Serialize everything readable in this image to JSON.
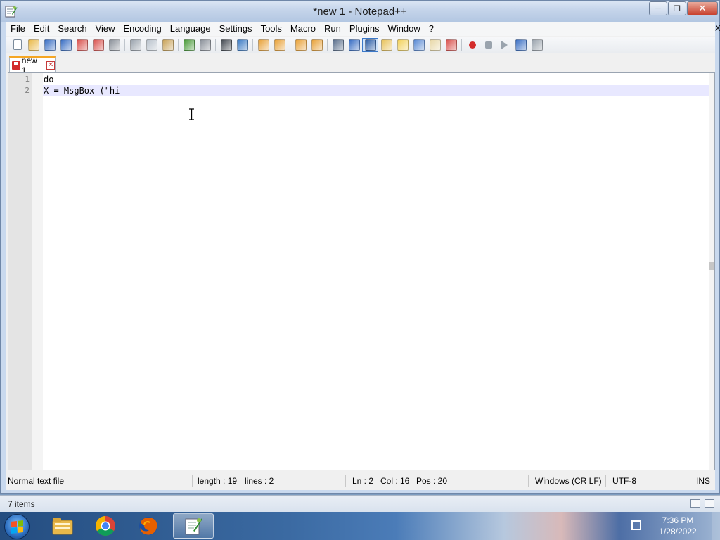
{
  "window": {
    "title": "*new 1 - Notepad++",
    "minimize_glyph": "─",
    "maximize_glyph": "❐",
    "close_glyph": "✕"
  },
  "menu": {
    "items": [
      "File",
      "Edit",
      "Search",
      "View",
      "Encoding",
      "Language",
      "Settings",
      "Tools",
      "Macro",
      "Run",
      "Plugins",
      "Window",
      "?"
    ],
    "close_glyph": "X"
  },
  "toolbar": {
    "icons": [
      "new-file-icon",
      "open-file-icon",
      "save-icon",
      "save-all-icon",
      "close-icon",
      "close-all-icon",
      "print-icon",
      "|",
      "cut-icon",
      "copy-icon",
      "paste-icon",
      "|",
      "undo-icon",
      "redo-icon",
      "|",
      "find-icon",
      "replace-icon",
      "|",
      "zoom-in-icon",
      "zoom-out-icon",
      "|",
      "sync-vertical-icon",
      "sync-horizontal-icon",
      "|",
      "word-wrap-icon",
      "show-all-chars-icon",
      "indent-guide-icon",
      "user-language-icon",
      "doc-map-icon",
      "function-list-icon",
      "folder-as-workspace-icon",
      "monitoring-icon",
      "|",
      "record-macro-icon",
      "stop-macro-icon",
      "play-macro-icon",
      "run-macro-multiple-icon",
      "save-macro-icon"
    ],
    "active_icon": "indent-guide-icon"
  },
  "tab": {
    "label": "new 1",
    "close_glyph": "✕"
  },
  "editor": {
    "lines": [
      {
        "number": "1",
        "text": "do"
      },
      {
        "number": "2",
        "text": "X = MsgBox (\"hi"
      }
    ]
  },
  "status": {
    "file_type": "Normal text file",
    "length": "length : 19",
    "lines": "lines : 2",
    "ln": "Ln : 2",
    "col": "Col : 16",
    "pos": "Pos : 20",
    "eol": "Windows (CR LF)",
    "encoding": "UTF-8",
    "mode": "INS"
  },
  "explorer": {
    "items_count": "7 items"
  },
  "taskbar": {
    "apps": [
      "file-explorer-icon",
      "chrome-icon",
      "firefox-icon",
      "notepad-plus-plus-icon"
    ],
    "active_app": "notepad-plus-plus-icon",
    "time": "7:36 PM",
    "date": "1/28/2022"
  },
  "colors": {
    "current_line": "#e8e8ff",
    "tab_accent": "#f5a623",
    "close_button": "#c8412e"
  }
}
